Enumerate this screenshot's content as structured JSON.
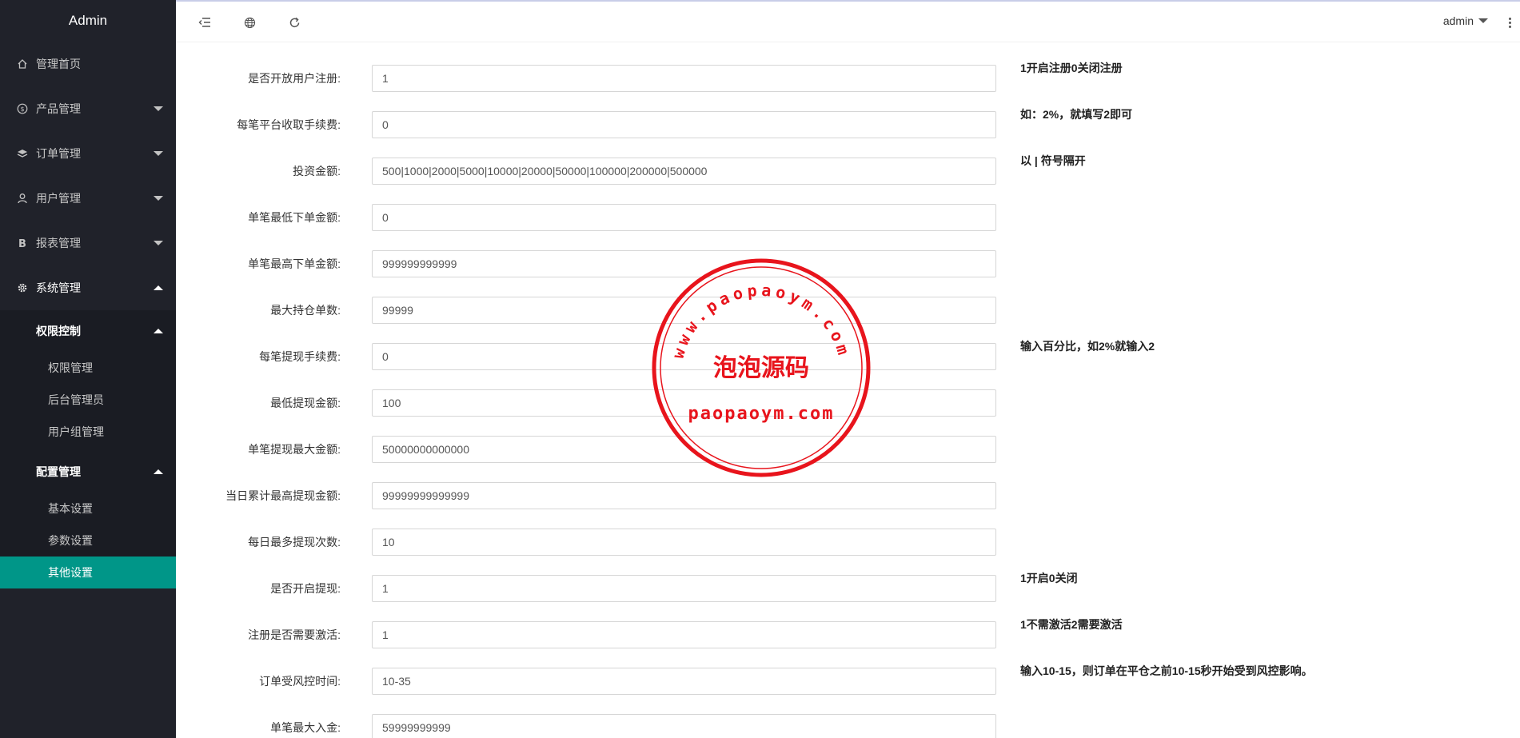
{
  "app": {
    "title": "Admin"
  },
  "sidebar": {
    "items": [
      {
        "label": "管理首页",
        "icon": "home-icon"
      },
      {
        "label": "产品管理",
        "icon": "dollar-icon"
      },
      {
        "label": "订单管理",
        "icon": "layers-icon"
      },
      {
        "label": "用户管理",
        "icon": "user-icon"
      },
      {
        "label": "报表管理",
        "icon": "b-icon"
      },
      {
        "label": "系统管理",
        "icon": "gear-icon"
      }
    ],
    "groups": [
      {
        "label": "权限控制",
        "items": [
          "权限管理",
          "后台管理员",
          "用户组管理"
        ]
      },
      {
        "label": "配置管理",
        "items": [
          "基本设置",
          "参数设置",
          "其他设置"
        ]
      }
    ],
    "active_item": "其他设置",
    "active_color": "#009688"
  },
  "topbar": {
    "user": "admin",
    "icons": [
      "menu-toggle-icon",
      "globe-icon",
      "refresh-icon",
      "more-vertical-icon"
    ]
  },
  "form": {
    "fields": [
      {
        "label": "是否开放用户注册:",
        "value": "1",
        "hint": "1开启注册0关闭注册"
      },
      {
        "label": "每笔平台收取手续费:",
        "value": "0",
        "hint": "如：2%，就填写2即可"
      },
      {
        "label": "投资金额:",
        "value": "500|1000|2000|5000|10000|20000|50000|100000|200000|500000",
        "hint": "以 | 符号隔开"
      },
      {
        "label": "单笔最低下单金额:",
        "value": "0",
        "hint": ""
      },
      {
        "label": "单笔最高下单金额:",
        "value": "999999999999",
        "hint": ""
      },
      {
        "label": "最大持仓单数:",
        "value": "99999",
        "hint": ""
      },
      {
        "label": "每笔提现手续费:",
        "value": "0",
        "hint": "输入百分比，如2%就输入2"
      },
      {
        "label": "最低提现金额:",
        "value": "100",
        "hint": ""
      },
      {
        "label": "单笔提现最大金额:",
        "value": "50000000000000",
        "hint": ""
      },
      {
        "label": "当日累计最高提现金额:",
        "value": "99999999999999",
        "hint": ""
      },
      {
        "label": "每日最多提现次数:",
        "value": "10",
        "hint": ""
      },
      {
        "label": "是否开启提现:",
        "value": "1",
        "hint": "1开启0关闭"
      },
      {
        "label": "注册是否需要激活:",
        "value": "1",
        "hint": "1不需激活2需要激活"
      },
      {
        "label": "订单受风控时间:",
        "value": "10-35",
        "hint": "输入10-15，则订单在平仓之前10-15秒开始受到风控影响。"
      },
      {
        "label": "单笔最大入金:",
        "value": "59999999999",
        "hint": ""
      }
    ]
  },
  "watermark": {
    "arc_text": "www.paopaoym.com",
    "center_text": "泡泡源码",
    "bottom_text": "paopaoym.com",
    "color": "#e8141c"
  }
}
